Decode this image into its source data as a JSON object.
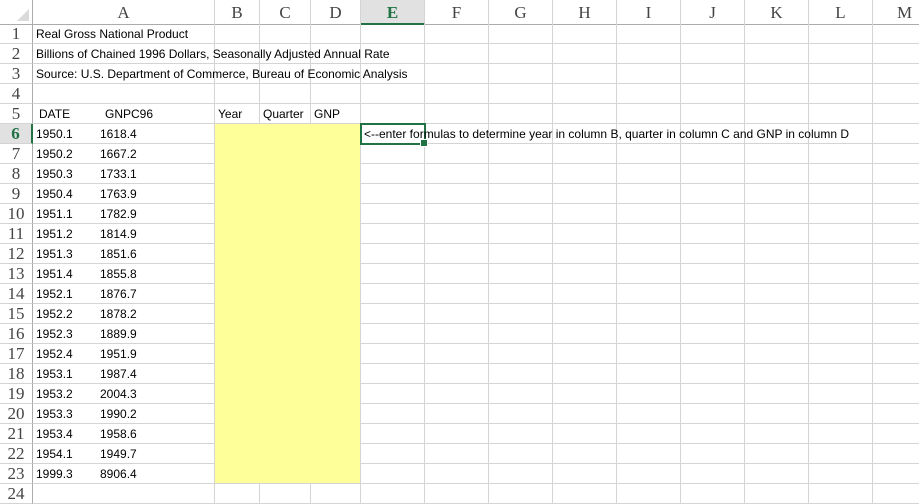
{
  "columns": [
    "A",
    "B",
    "C",
    "D",
    "E",
    "F",
    "G",
    "H",
    "I",
    "J",
    "K",
    "L",
    "M"
  ],
  "selected_column": "E",
  "selected_row": 6,
  "row_numbers": [
    1,
    2,
    3,
    4,
    5,
    6,
    7,
    8,
    9,
    10,
    11,
    12,
    13,
    14,
    15,
    16,
    17,
    18,
    19,
    20,
    21,
    22,
    23,
    24
  ],
  "title_rows": [
    "Real Gross National Product",
    "Billions of Chained 1996 Dollars, Seasonally Adjusted Annual Rate",
    "Source: U.S. Department of Commerce, Bureau of Economic Analysis"
  ],
  "headers": {
    "date": "DATE",
    "gnpc96": "GNPC96",
    "year": "Year",
    "quarter": "Quarter",
    "gnp": "GNP"
  },
  "instruction": "<--enter formulas to determine year in column B, quarter in column C and GNP in column D",
  "data_rows": [
    [
      "1950.1",
      "1618.4"
    ],
    [
      "1950.2",
      "1667.2"
    ],
    [
      "1950.3",
      "1733.1"
    ],
    [
      "1950.4",
      "1763.9"
    ],
    [
      "1951.1",
      "1782.9"
    ],
    [
      "1951.2",
      "1814.9"
    ],
    [
      "1951.3",
      "1851.6"
    ],
    [
      "1951.4",
      "1855.8"
    ],
    [
      "1952.1",
      "1876.7"
    ],
    [
      "1952.2",
      "1878.2"
    ],
    [
      "1952.3",
      "1889.9"
    ],
    [
      "1952.4",
      "1951.9"
    ],
    [
      "1953.1",
      "1987.4"
    ],
    [
      "1953.2",
      "2004.3"
    ],
    [
      "1953.3",
      "1990.2"
    ],
    [
      "1953.4",
      "1958.6"
    ],
    [
      "1954.1",
      "1949.7"
    ],
    [
      "1999.3",
      "8906.4"
    ]
  ],
  "colors": {
    "accent": "#217346",
    "input_fill": "#ffff99"
  }
}
